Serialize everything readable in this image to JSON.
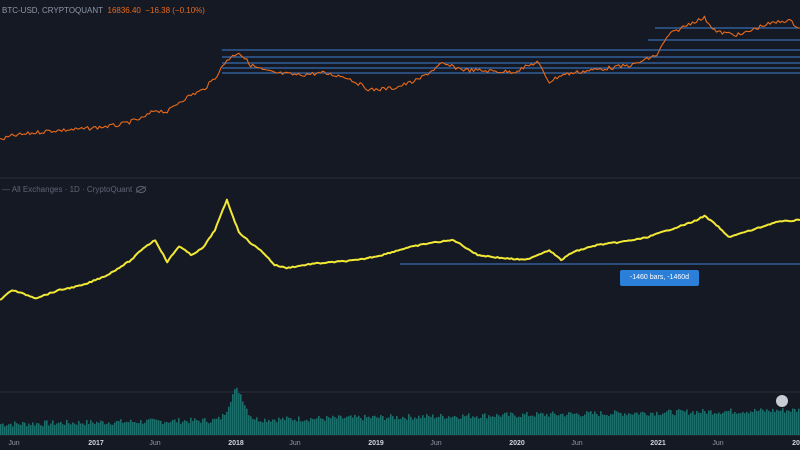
{
  "price_legend": {
    "symbol": "BTC-USD, CRYPTOQUANT",
    "value": "16836.40",
    "change": "−16.38 (−0.10%)"
  },
  "indicator_legend": {
    "text": "— All Exchanges · 1D · CryptoQuant"
  },
  "measure_tag": "-1460 bars, -1460d",
  "colors": {
    "price": "#e86a1a",
    "indicator": "#f2e836",
    "volume": "#1f8c83",
    "hlines": "#3f7ed0",
    "tag": "#2b7fd8",
    "background": "#151924"
  },
  "chart_data": [
    {
      "type": "line",
      "series": [
        {
          "name": "BTC-USD",
          "x": [
            "2016-05",
            "2016-06",
            "2016-09",
            "2016-12",
            "2017-03",
            "2017-05",
            "2017-06",
            "2017-07",
            "2017-08",
            "2017-09",
            "2017-10",
            "2017-11",
            "2017-12",
            "2018-01",
            "2018-02",
            "2018-03",
            "2018-04",
            "2018-06",
            "2018-08",
            "2018-10",
            "2018-12",
            "2019-02",
            "2019-04",
            "2019-06",
            "2019-08",
            "2019-10",
            "2019-12",
            "2020-02",
            "2020-03",
            "2020-04",
            "2020-06",
            "2020-08",
            "2020-10",
            "2020-12",
            "2021-01",
            "2021-03",
            "2021-04",
            "2021-05",
            "2021-07",
            "2021-09",
            "2021-11",
            "2021-12"
          ],
          "values": [
            140,
            136,
            131,
            129,
            125,
            118,
            110,
            112,
            102,
            95,
            90,
            78,
            60,
            52,
            65,
            70,
            73,
            75,
            73,
            77,
            90,
            88,
            80,
            64,
            70,
            71,
            72,
            62,
            82,
            75,
            71,
            68,
            65,
            55,
            35,
            22,
            18,
            32,
            35,
            25,
            20,
            28
          ]
        }
      ],
      "value_unit": "plot scale (0 = top of pane)",
      "horizontal_levels": [
        28,
        40,
        50,
        57,
        63,
        68,
        73
      ]
    },
    {
      "type": "line",
      "series": [
        {
          "name": "All Exchanges",
          "x": [
            "2016-05",
            "2016-06",
            "2016-08",
            "2016-10",
            "2016-12",
            "2017-02",
            "2017-04",
            "2017-05",
            "2017-06",
            "2017-07",
            "2017-08",
            "2017-09",
            "2017-10",
            "2017-11",
            "2017-12",
            "2018-01",
            "2018-02",
            "2018-03",
            "2018-04",
            "2018-05",
            "2018-07",
            "2018-09",
            "2018-11",
            "2019-01",
            "2019-03",
            "2019-05",
            "2019-07",
            "2019-09",
            "2019-11",
            "2020-01",
            "2020-03",
            "2020-04",
            "2020-05",
            "2020-07",
            "2020-09",
            "2020-11",
            "2021-01",
            "2021-03",
            "2021-04",
            "2021-05",
            "2021-06",
            "2021-08",
            "2021-10",
            "2021-12"
          ],
          "values": [
            300,
            290,
            298,
            290,
            285,
            275,
            260,
            248,
            240,
            262,
            246,
            255,
            248,
            230,
            200,
            232,
            243,
            252,
            265,
            268,
            264,
            262,
            260,
            255,
            248,
            243,
            240,
            255,
            258,
            260,
            250,
            260,
            252,
            245,
            242,
            238,
            230,
            222,
            216,
            225,
            237,
            230,
            222,
            220
          ]
        }
      ],
      "value_unit": "plot scale (0 = top of pane)",
      "horizontal_levels": [
        264
      ]
    }
  ],
  "x_axis": [
    {
      "label": "Jun",
      "year": false
    },
    {
      "label": "2017",
      "year": true
    },
    {
      "label": "Jun",
      "year": false
    },
    {
      "label": "2018",
      "year": true
    },
    {
      "label": "Jun",
      "year": false
    },
    {
      "label": "2019",
      "year": true
    },
    {
      "label": "Jun",
      "year": false
    },
    {
      "label": "2020",
      "year": true
    },
    {
      "label": "Jun",
      "year": false
    },
    {
      "label": "2021",
      "year": true
    },
    {
      "label": "Jun",
      "year": false
    },
    {
      "label": "20",
      "year": true
    }
  ]
}
